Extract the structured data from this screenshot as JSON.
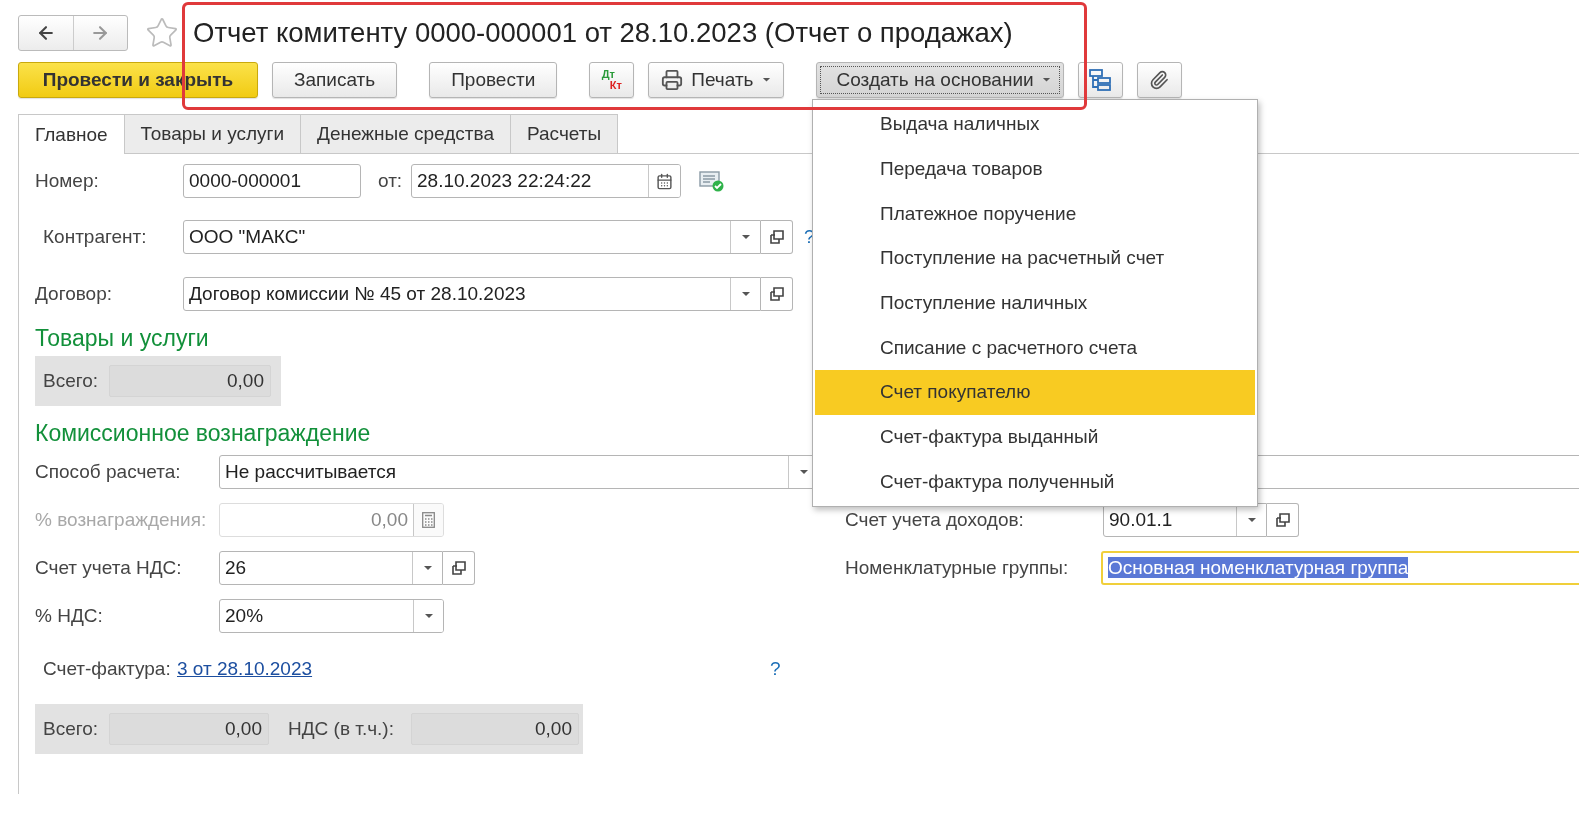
{
  "title": "Отчет комитенту 0000-000001 от 28.10.2023 (Отчет о продажах)",
  "toolbar": [
    {
      "kind": "primary",
      "label": "Провести и закрыть"
    },
    {
      "kind": "plain",
      "label": "Записать"
    },
    {
      "kind": "plain",
      "label": "Провести"
    },
    {
      "kind": "dtkt",
      "labels": [
        "Дт",
        "Кт"
      ]
    },
    {
      "kind": "print",
      "label": "Печать"
    },
    {
      "kind": "dropdown",
      "label": "Создать на основании",
      "expanded": true
    },
    {
      "kind": "structure"
    },
    {
      "kind": "attach"
    }
  ],
  "tabs": [
    {
      "label": "Главное",
      "selected": true
    },
    {
      "label": "Товары и услуги",
      "selected": false
    },
    {
      "label": "Денежные средства",
      "selected": false
    },
    {
      "label": "Расчеты",
      "selected": false
    }
  ],
  "number": {
    "label": "Номер:",
    "value": "0000-000001"
  },
  "date": {
    "label": "от:",
    "value": "28.10.2023 22:24:22"
  },
  "counterparty": {
    "label": "Контрагент:",
    "value": "ООО \"МАКС\"",
    "help": "?"
  },
  "contract": {
    "label": "Договор:",
    "value": "Договор комиссии № 45 от 28.10.2023"
  },
  "goods": {
    "heading": "Товары и услуги",
    "total_label": "Всего:",
    "total": "0,00"
  },
  "commission": {
    "heading": "Комиссионное вознаграждение",
    "method": {
      "label": "Способ расчета:",
      "value": "Не рассчитывается"
    },
    "percent": {
      "label": "% вознаграждения:",
      "value": "0,00",
      "disabled": true
    },
    "vat_account": {
      "label": "Счет учета НДС:",
      "value": "26"
    },
    "vat_rate": {
      "label": "% НДС:",
      "value": "20%"
    },
    "income_account": {
      "label": "Счет учета доходов:",
      "value": "90.01.1"
    },
    "item_groups": {
      "label": "Номенклатурные группы:",
      "value": "Основная номенклатурная группа",
      "focused": true,
      "highlighted": true
    },
    "invoice": {
      "label": "Счет-фактура:",
      "link": "3 от 28.10.2023",
      "help": "?"
    },
    "totals": [
      {
        "label": "Всего:",
        "value": "0,00"
      },
      {
        "label": "НДС (в т.ч.):",
        "value": "0,00"
      }
    ]
  },
  "menu": {
    "items": [
      {
        "label": "Выдача наличных",
        "selected": false
      },
      {
        "label": "Передача товаров",
        "selected": false
      },
      {
        "label": "Платежное поручение",
        "selected": false
      },
      {
        "label": "Поступление на расчетный счет",
        "selected": false
      },
      {
        "label": "Поступление наличных",
        "selected": false
      },
      {
        "label": "Списание с расчетного счета",
        "selected": false
      },
      {
        "label": "Счет покупателю",
        "selected": true
      },
      {
        "label": "Счет-фактура выданный",
        "selected": false
      },
      {
        "label": "Счет-фактура полученный",
        "selected": false
      }
    ]
  }
}
